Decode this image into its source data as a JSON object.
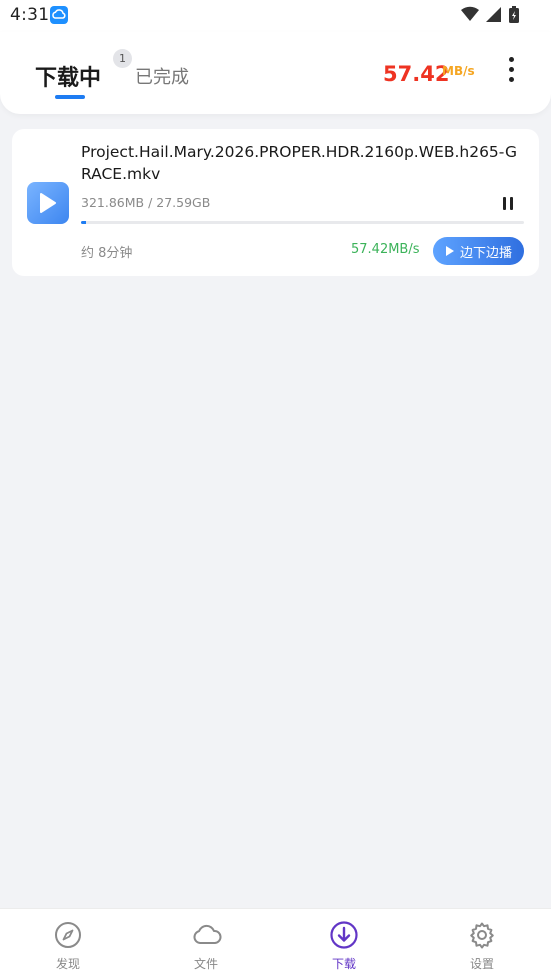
{
  "status_bar": {
    "time": "4:31"
  },
  "tabs": {
    "downloading_label": "下载中",
    "downloading_badge": "1",
    "completed_label": "已完成"
  },
  "header": {
    "speed_value": "57.42",
    "speed_unit": "MB/s",
    "speed_color": "#ee3322",
    "unit_color": "#f5a623"
  },
  "download": {
    "file_name": "Project.Hail.Mary.2026.PROPER.HDR.2160p.WEB.h265-GRACE.mkv",
    "size_progress": "321.86MB / 27.59GB",
    "progress_fraction": 0.0114,
    "eta": "约 8分钟",
    "speed": "57.42MB/s",
    "play_while_label": "边下边播"
  },
  "nav": {
    "items": [
      {
        "label": "发现",
        "icon": "compass-icon"
      },
      {
        "label": "文件",
        "icon": "cloud-icon"
      },
      {
        "label": "下载",
        "icon": "download-circle-icon"
      },
      {
        "label": "设置",
        "icon": "gear-icon"
      }
    ],
    "active_index": 2,
    "active_color": "#6236c6"
  }
}
